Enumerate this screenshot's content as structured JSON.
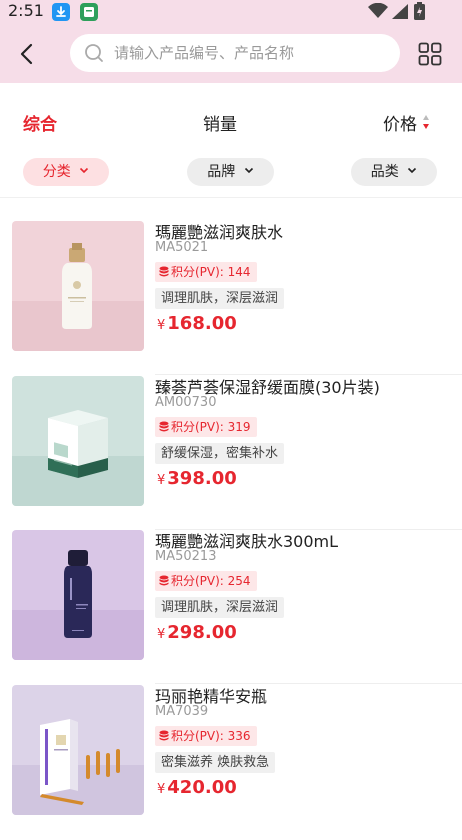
{
  "status_bar": {
    "time": "2:51"
  },
  "search": {
    "placeholder": "请输入产品编号、产品名称"
  },
  "sort_tabs": [
    {
      "label": "综合",
      "active": true
    },
    {
      "label": "销量",
      "active": false
    },
    {
      "label": "价格",
      "active": false
    }
  ],
  "filters": [
    {
      "label": "分类",
      "active": true
    },
    {
      "label": "品牌",
      "active": false
    },
    {
      "label": "品类",
      "active": false
    }
  ],
  "products": [
    {
      "name": "瑪麗艷滋润爽肤水",
      "code": "MA5021",
      "pv": "积分(PV): 144",
      "tag": "调理肌肤，深层滋润",
      "currency": "¥",
      "price": "168.00"
    },
    {
      "name": "臻荟芦荟保湿舒缓面膜(30片装)",
      "code": "AM00730",
      "pv": "积分(PV): 319",
      "tag": "舒缓保湿，密集补水",
      "currency": "¥",
      "price": "398.00"
    },
    {
      "name": "瑪麗艷滋润爽肤水300mL",
      "code": "MA50213",
      "pv": "积分(PV): 254",
      "tag": "调理肌肤，深层滋润",
      "currency": "¥",
      "price": "298.00"
    },
    {
      "name": "玛丽艳精华安瓶",
      "code": "MA7039",
      "pv": "积分(PV): 336",
      "tag": "密集滋养 焕肤救急",
      "currency": "¥",
      "price": "420.00"
    }
  ],
  "colors": {
    "accent": "#e6262f",
    "header_bg": "#f6dde8"
  }
}
